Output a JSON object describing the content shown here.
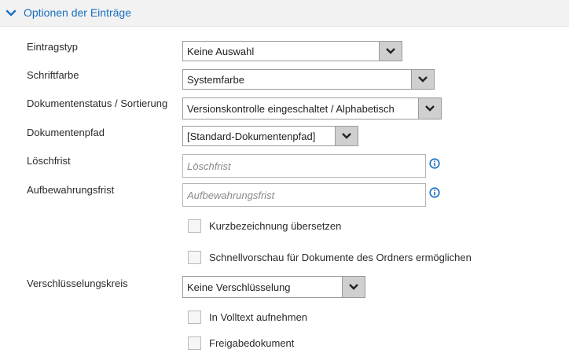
{
  "section": {
    "title": "Optionen der Einträge",
    "accent": "#1a6fc0"
  },
  "fields": {
    "eintragstyp": {
      "label": "Eintragstyp",
      "value": "Keine Auswahl"
    },
    "schriftfarbe": {
      "label": "Schriftfarbe",
      "value": "Systemfarbe"
    },
    "dokumentenstatus": {
      "label": "Dokumentenstatus / Sortierung",
      "value": "Versionskontrolle eingeschaltet / Alphabetisch"
    },
    "dokumentenpfad": {
      "label": "Dokumentenpfad",
      "value": "[Standard-Dokumentenpfad]"
    },
    "loeschfrist": {
      "label": "Löschfrist",
      "placeholder": "Löschfrist"
    },
    "aufbewahrungsfrist": {
      "label": "Aufbewahrungsfrist",
      "placeholder": "Aufbewahrungsfrist"
    },
    "verschluesselungskreis": {
      "label": "Verschlüsselungskreis",
      "value": "Keine Verschlüsselung"
    }
  },
  "checkboxes": {
    "kurzbezeichnung": {
      "label": "Kurzbezeichnung übersetzen",
      "checked": false
    },
    "schnellvorschau": {
      "label": "Schnellvorschau für Dokumente des Ordners ermöglichen",
      "checked": false
    },
    "volltext": {
      "label": "In Volltext aufnehmen",
      "checked": false
    },
    "freigabedokument": {
      "label": "Freigabedokument",
      "checked": false
    }
  },
  "icons": {
    "section_toggle": "chevron-down-icon",
    "info": "info-icon",
    "dropdown": "chevron-down-icon"
  }
}
